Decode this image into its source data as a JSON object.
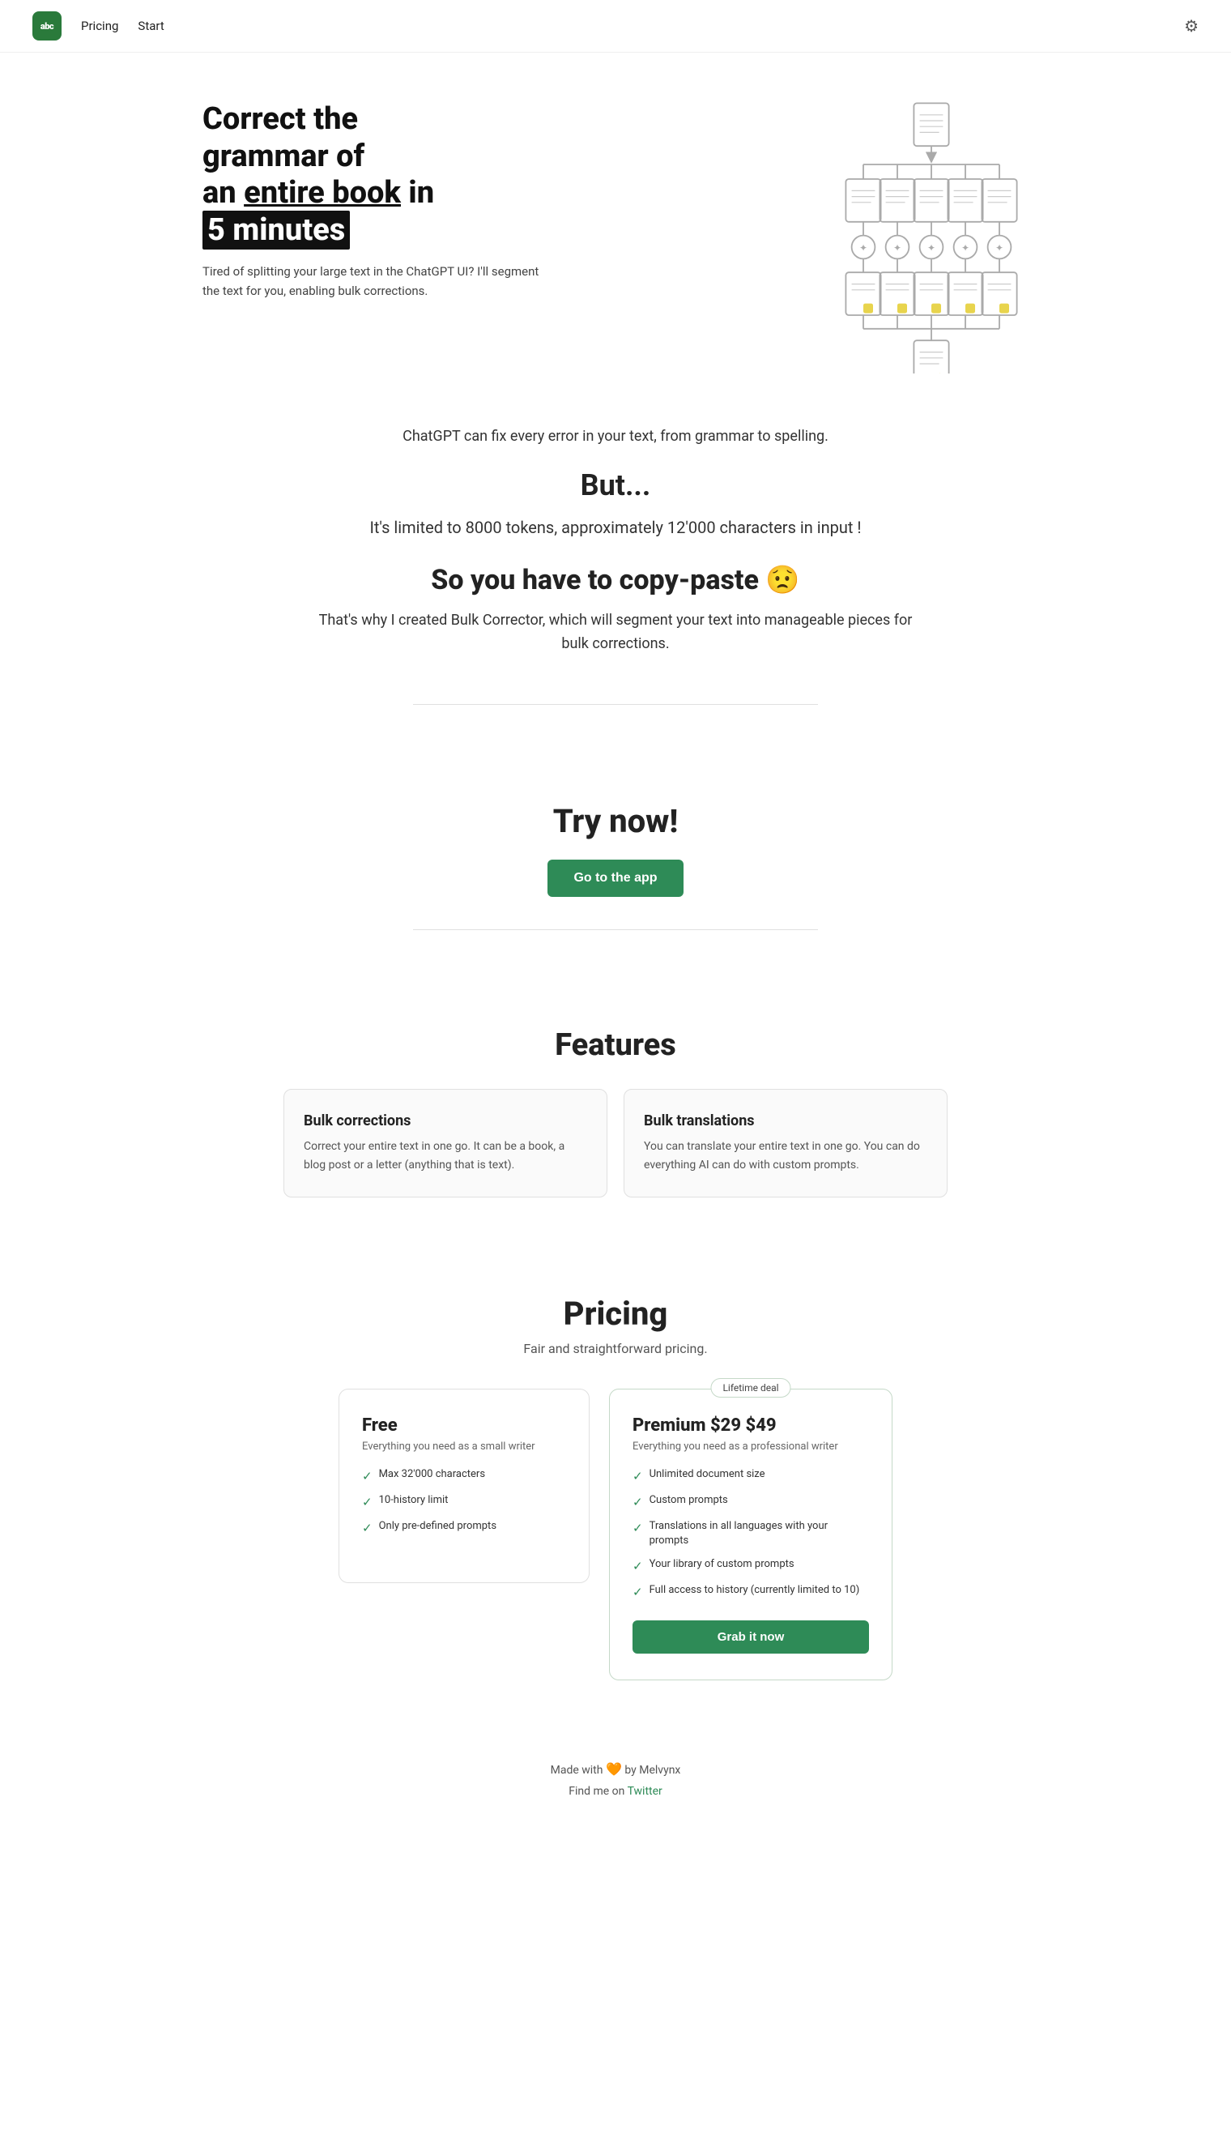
{
  "nav": {
    "logo_text": "abc",
    "links": [
      {
        "label": "Pricing",
        "id": "pricing"
      },
      {
        "label": "Start",
        "id": "start"
      }
    ],
    "settings_icon": "⚙"
  },
  "hero": {
    "title_line1": "Correct the",
    "title_line2": "grammar of",
    "title_line3_pre": "an ",
    "title_underline": "entire book",
    "title_line3_post": " in",
    "title_highlight": "5 minutes",
    "subtitle": "Tired of splitting your large text in the ChatGPT UI? I'll segment the text for you, enabling bulk corrections."
  },
  "intro": {
    "chatgpt_line": "ChatGPT can fix every error in your text, from grammar to spelling.",
    "but_title": "But...",
    "limited_text": "It's limited to 8000 tokens, approximately 12'000 characters in input !",
    "copy_paste_title": "So you have to copy-paste 😟",
    "why_text": "That's why I created Bulk Corrector, which will segment your text into manageable pieces for bulk corrections."
  },
  "try_section": {
    "title": "Try now!",
    "button_label": "Go to the app"
  },
  "features": {
    "title": "Features",
    "cards": [
      {
        "title": "Bulk corrections",
        "desc": "Correct your entire text in one go. It can be a book, a blog post or a letter (anything that is text)."
      },
      {
        "title": "Bulk translations",
        "desc": "You can translate your entire text in one go. You can do everything AI can do with custom prompts."
      }
    ]
  },
  "pricing": {
    "title": "Pricing",
    "subtitle": "Fair and straightforward pricing.",
    "free": {
      "name": "Free",
      "desc": "Everything you need as a small writer",
      "features": [
        "Max 32'000 characters",
        "10-history limit",
        "Only pre-defined prompts"
      ]
    },
    "premium": {
      "badge": "Lifetime deal",
      "name": "Premium $29",
      "price": "$29",
      "old_price": "$49",
      "desc": "Everything you need as a professional writer",
      "features": [
        "Unlimited document size",
        "Custom prompts",
        "Translations in all languages with your prompts",
        "Your library of custom prompts",
        "Full access to history (currently limited to 10)"
      ],
      "button_label": "Grab it now"
    }
  },
  "footer": {
    "made_with": "Made with",
    "heart": "🧡",
    "by": "by Melvynx",
    "find_me": "Find me on",
    "twitter_label": "Twitter"
  }
}
